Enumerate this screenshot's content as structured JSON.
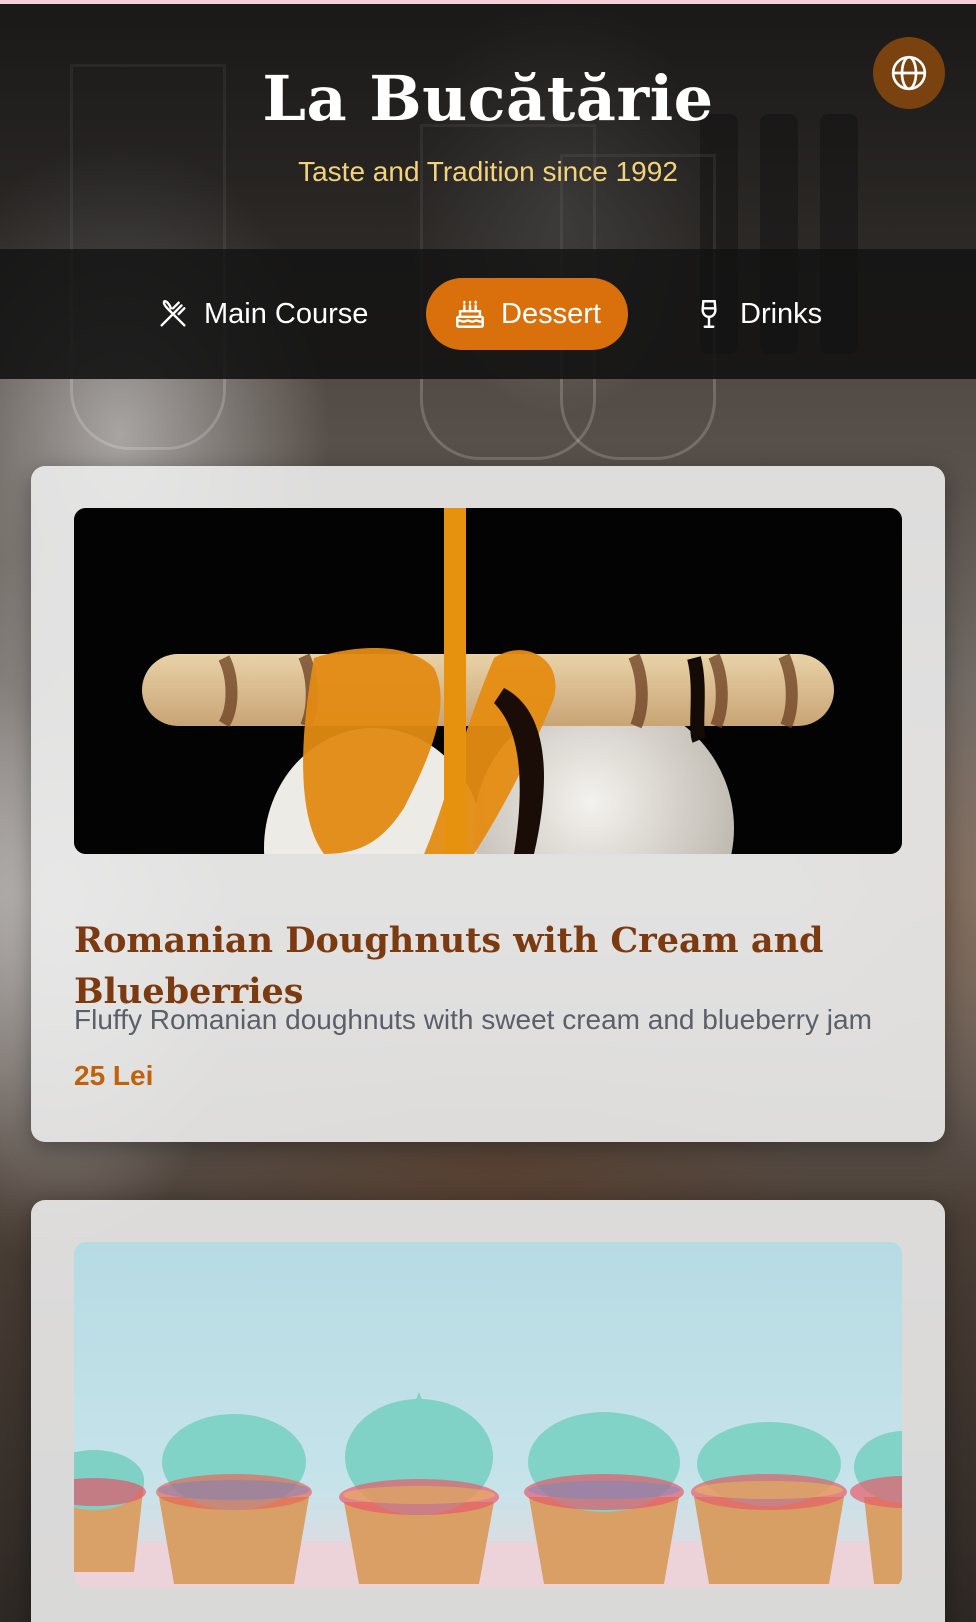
{
  "brand": {
    "title": "La Bucătărie",
    "tagline": "Taste and Tradition since 1992"
  },
  "header": {
    "language_icon": "globe-icon"
  },
  "nav": {
    "tabs": [
      {
        "label": "Main Course",
        "icon": "utensils-icon",
        "active": false
      },
      {
        "label": "Dessert",
        "icon": "cake-icon",
        "active": true
      },
      {
        "label": "Drinks",
        "icon": "wine-glass-icon",
        "active": false
      }
    ]
  },
  "menu": {
    "items": [
      {
        "name": "Romanian Doughnuts with Cream and Blueberries",
        "description": "Fluffy Romanian doughnuts with sweet cream and blueberry jam",
        "price": "25 Lei"
      }
    ]
  },
  "colors": {
    "accent": "#d9700b",
    "title_text": "#7b3a10",
    "price_text": "#c0620c",
    "tagline_text": "#f2d27a",
    "language_button": "#7a420e"
  }
}
